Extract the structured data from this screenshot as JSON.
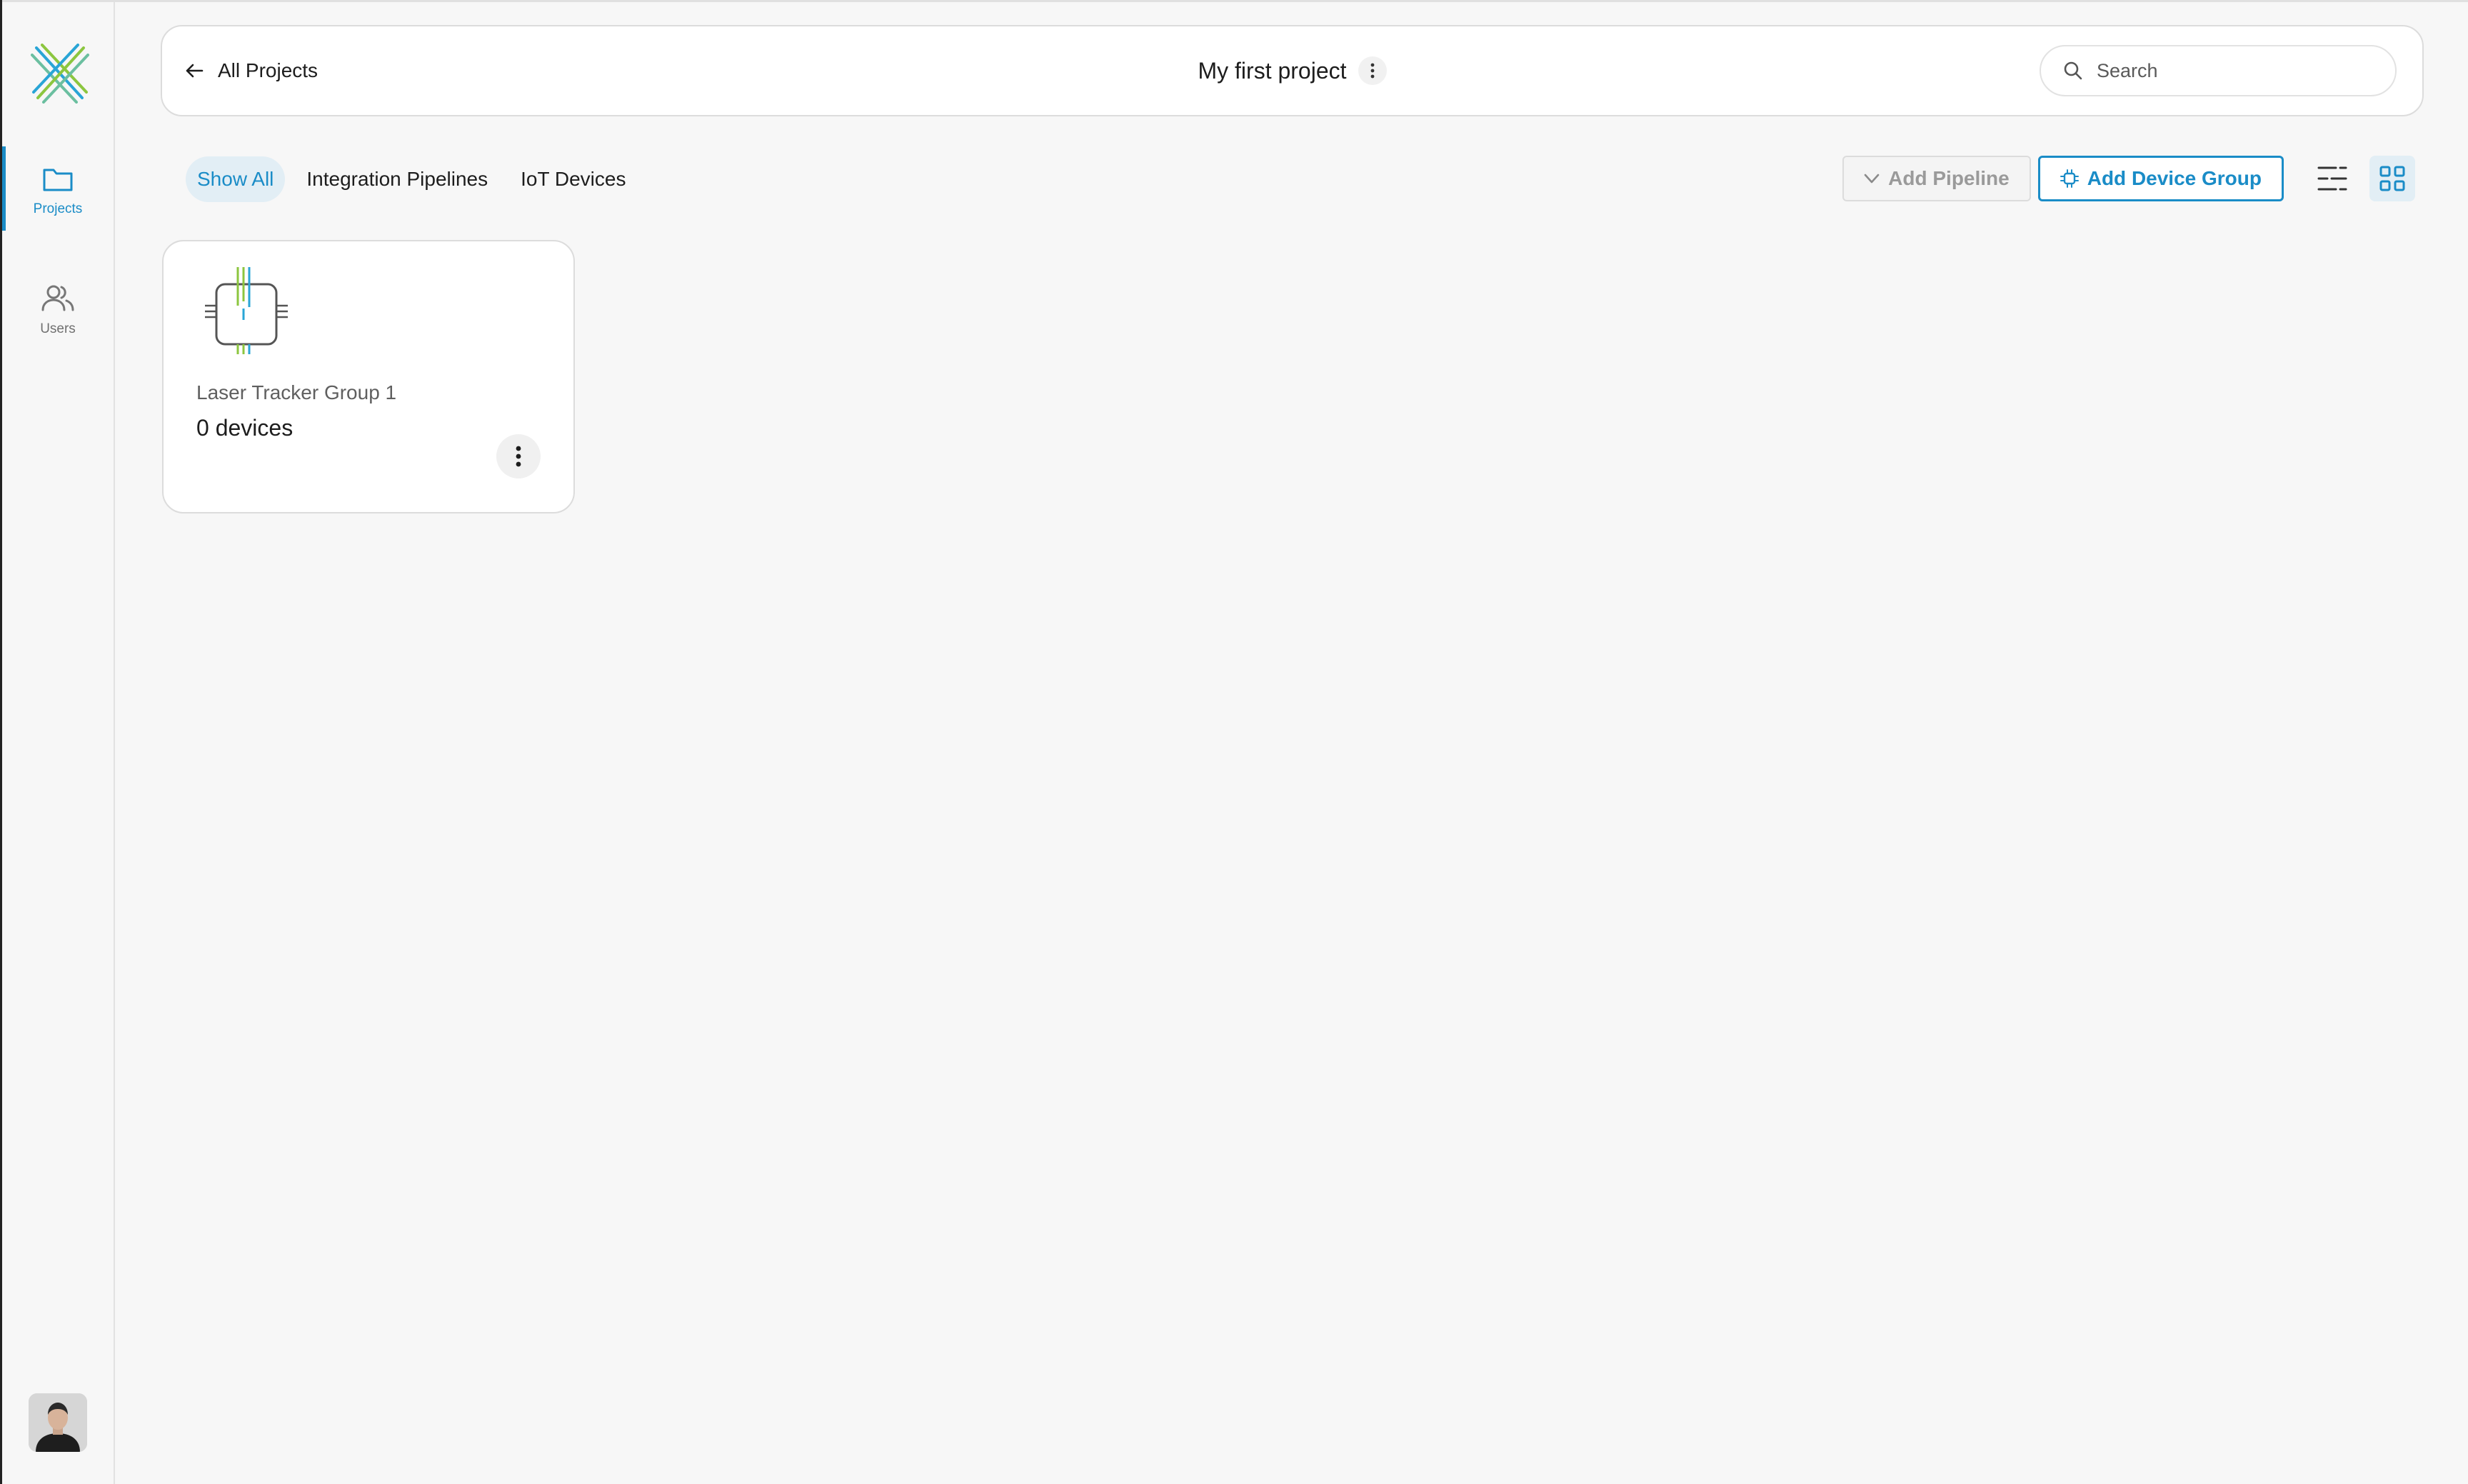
{
  "sidebar": {
    "logo_icon": "brand-x-logo",
    "items": [
      {
        "id": "projects",
        "label": "Projects",
        "icon": "folder-icon",
        "active": true
      },
      {
        "id": "users",
        "label": "Users",
        "icon": "users-icon",
        "active": false
      }
    ],
    "avatar_icon": "user-avatar"
  },
  "header": {
    "back_label": "All Projects",
    "back_icon": "arrow-left-icon",
    "project_title": "My first project",
    "project_menu_icon": "vertical-dots-icon",
    "search_placeholder": "Search",
    "search_icon": "search-icon"
  },
  "toolbar": {
    "tabs": [
      {
        "label": "Show All",
        "active": true
      },
      {
        "label": "Integration Pipelines",
        "active": false
      },
      {
        "label": "IoT Devices",
        "active": false
      }
    ],
    "add_pipeline_label": "Add Pipeline",
    "add_device_group_label": "Add Device Group",
    "list_view_icon": "list-view-icon",
    "grid_view_icon": "grid-view-icon",
    "view_mode": "grid"
  },
  "cards": [
    {
      "name": "Laser Tracker Group 1",
      "count": "0 devices",
      "icon": "chip-icon"
    }
  ],
  "colors": {
    "accent": "#1a8cc7",
    "accent_bg": "#e2eef5",
    "page_bg": "#f7f7f7",
    "logo_green": "#8cc63f",
    "logo_blue": "#29a5d6"
  }
}
